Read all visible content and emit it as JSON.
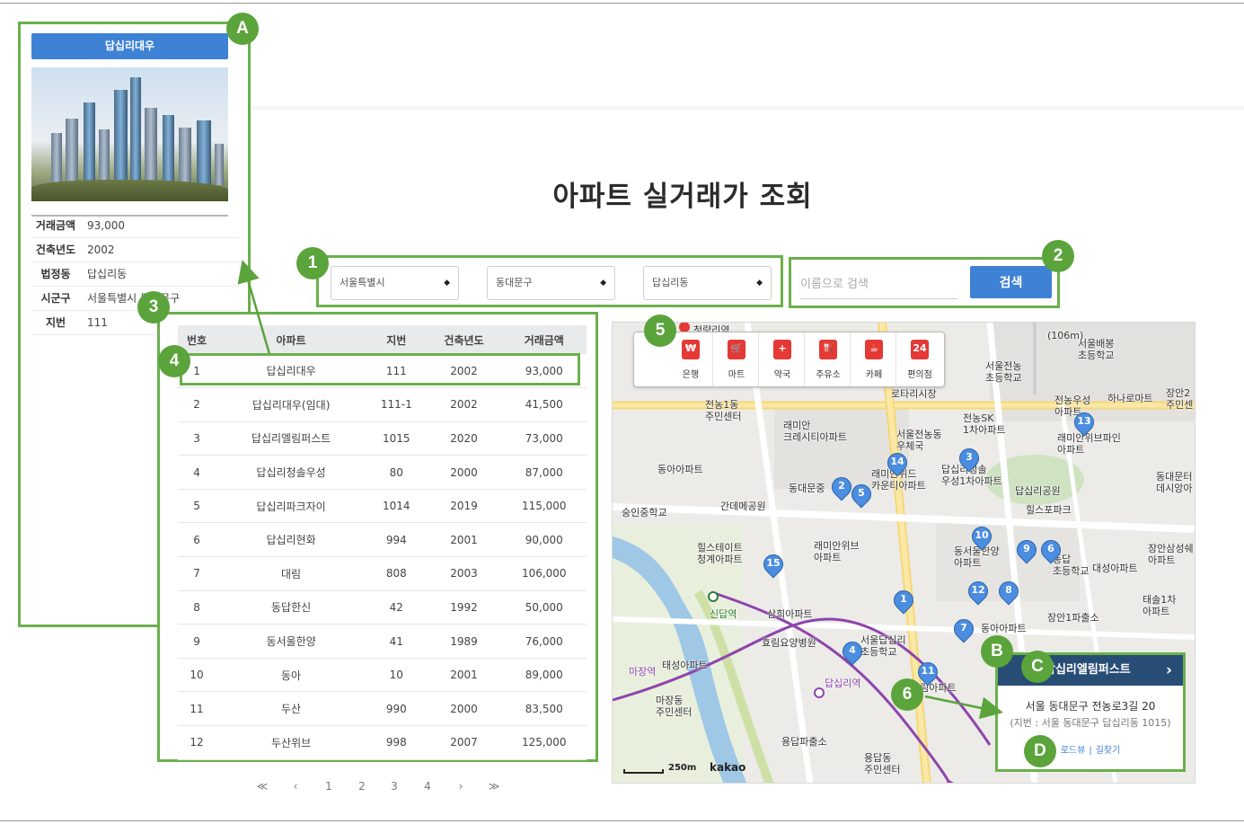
{
  "page": {
    "title": "아파트 실거래가 조회"
  },
  "side_card": {
    "name": "답십리대우",
    "info": [
      {
        "key": "거래금액",
        "value": "93,000"
      },
      {
        "key": "건축년도",
        "value": "2002"
      },
      {
        "key": "법정동",
        "value": "답십리동"
      },
      {
        "key": "시군구",
        "value": "서울특별시 동대문구"
      },
      {
        "key": "지번",
        "value": "111"
      }
    ]
  },
  "filters": {
    "sido": "서울특별시",
    "gugun": "동대문구",
    "dong": "답십리동"
  },
  "search": {
    "placeholder": "이름으로 검색",
    "button": "검색"
  },
  "table": {
    "headers": [
      "번호",
      "아파트",
      "지번",
      "건축년도",
      "거래금액"
    ],
    "rows": [
      [
        "1",
        "답십리대우",
        "111",
        "2002",
        "93,000"
      ],
      [
        "2",
        "답십리대우(임대)",
        "111-1",
        "2002",
        "41,500"
      ],
      [
        "3",
        "답십리엘림퍼스트",
        "1015",
        "2020",
        "73,000"
      ],
      [
        "4",
        "답십리청솔우성",
        "80",
        "2000",
        "87,000"
      ],
      [
        "5",
        "답십리파크자이",
        "1014",
        "2019",
        "115,000"
      ],
      [
        "6",
        "답십리현화",
        "994",
        "2001",
        "90,000"
      ],
      [
        "7",
        "대림",
        "808",
        "2003",
        "106,000"
      ],
      [
        "8",
        "동답한신",
        "42",
        "1992",
        "50,000"
      ],
      [
        "9",
        "동서울한양",
        "41",
        "1989",
        "76,000"
      ],
      [
        "10",
        "동아",
        "10",
        "2001",
        "89,000"
      ],
      [
        "11",
        "두산",
        "990",
        "2000",
        "83,500"
      ],
      [
        "12",
        "두산위브",
        "998",
        "2007",
        "125,000"
      ]
    ]
  },
  "pagination": {
    "first": "≪",
    "prev": "‹",
    "pages": [
      "1",
      "2",
      "3",
      "4"
    ],
    "next": "›",
    "last": "≫"
  },
  "map": {
    "poi": [
      {
        "label": "은행",
        "icon": "bank-icon",
        "glyph": "₩"
      },
      {
        "label": "마트",
        "icon": "cart-icon",
        "glyph": "🛒"
      },
      {
        "label": "약국",
        "icon": "pharmacy-icon",
        "glyph": "+"
      },
      {
        "label": "주유소",
        "icon": "gas-station-icon",
        "glyph": "⛽"
      },
      {
        "label": "카페",
        "icon": "cafe-icon",
        "glyph": "☕"
      },
      {
        "label": "편의점",
        "icon": "store-24-icon",
        "glyph": "24"
      }
    ],
    "place_labels": [
      "청량리역",
      "전농1동\n주민센터",
      "래미안\n크레시티아파트",
      "서울전농동\n우체국",
      "전농SK\n1차아파트",
      "로타리시장",
      "서울전농\n초등학교",
      "전농우성\n아파트",
      "하나로마트",
      "장안2\n주민센",
      "래미안위브파인\n아파트",
      "서울배봉\n초등학교",
      "동아아파트",
      "동대문중",
      "래미안위드\n카운티아파트",
      "답십리청솔\n우성1차아파트",
      "답십리공원",
      "힐스포파크",
      "동대문터\n데시앙아",
      "숭인중학교",
      "간데메공원",
      "힐스테이트\n청계아파트",
      "래미안위브\n아파트",
      "동서울한양\n아파트",
      "동답\n초등학교",
      "대성아파트",
      "장안삼성쉐\n아파트",
      "태솔1차\n아파트",
      "장안1파출소",
      "삼희아파트",
      "효림요양병원",
      "서울답십리\n초등학교",
      "동아아파트",
      "대림아파트",
      "태성아파트",
      "마장동\n주민센터",
      "용답파출소",
      "용답동\n주민센터",
      "답십리역",
      "신답역",
      "마장역",
      "(106m)"
    ],
    "markers": [
      "1",
      "2",
      "3",
      "4",
      "5",
      "6",
      "7",
      "8",
      "9",
      "10",
      "11",
      "12",
      "13",
      "14",
      "15"
    ],
    "scale": "250m",
    "logo": "kakao",
    "popup": {
      "title": "답십리엘림퍼스트",
      "address": "서울 동대문구 전농로3길 20",
      "jibun": "(지번 : 서울 동대문구 답십리동 1015)",
      "link_roadview": "로드뷰",
      "link_directions": "길찾기"
    }
  },
  "callouts": [
    "A",
    "B",
    "C",
    "D",
    "1",
    "2",
    "3",
    "4",
    "5",
    "6"
  ],
  "colors": {
    "accent": "#3e82d6",
    "callout": "#5ba33b",
    "frame": "#6ab04c",
    "popup_header": "#274d75",
    "marker": "#4b8de0",
    "poi_icon": "#e53935"
  }
}
